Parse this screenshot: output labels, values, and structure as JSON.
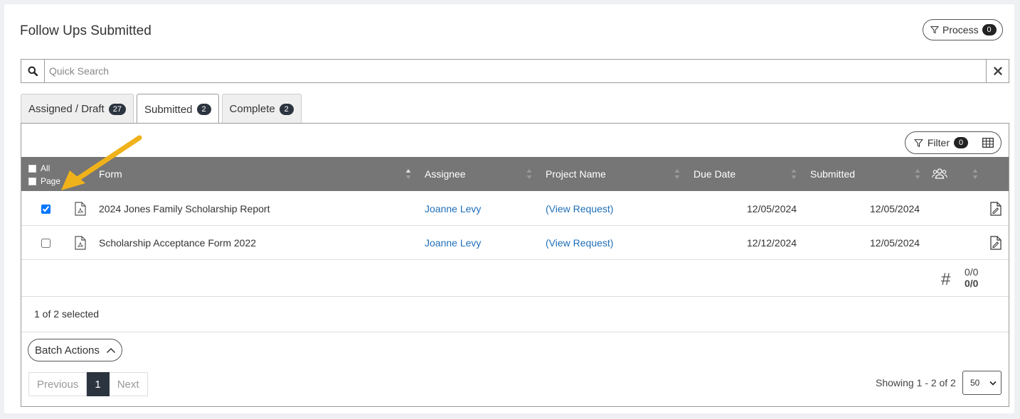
{
  "page": {
    "title": "Follow Ups Submitted"
  },
  "process": {
    "label": "Process",
    "count": "0"
  },
  "search": {
    "placeholder": "Quick Search"
  },
  "tabs": [
    {
      "label": "Assigned / Draft",
      "count": "27"
    },
    {
      "label": "Submitted",
      "count": "2"
    },
    {
      "label": "Complete",
      "count": "2"
    }
  ],
  "filter": {
    "label": "Filter",
    "count": "0"
  },
  "table": {
    "select_all_label": "All",
    "select_page_label": "Page",
    "columns": [
      "Form",
      "Assignee",
      "Project Name",
      "Due Date",
      "Submitted"
    ],
    "rows": [
      {
        "checked": true,
        "form": "2024 Jones Family Scholarship Report",
        "assignee": "Joanne Levy",
        "project": "(View Request)",
        "due": "12/05/2024",
        "submitted": "12/05/2024"
      },
      {
        "checked": false,
        "form": "Scholarship Acceptance Form 2022",
        "assignee": "Joanne Levy",
        "project": "(View Request)",
        "due": "12/12/2024",
        "submitted": "12/05/2024"
      }
    ]
  },
  "summary": {
    "value_top": "0/0",
    "value_bottom": "0/0"
  },
  "selection": {
    "text": "1 of 2 selected"
  },
  "batch": {
    "label": "Batch Actions"
  },
  "pagination": {
    "previous": "Previous",
    "current": "1",
    "next": "Next",
    "showing": "Showing 1 - 2 of 2",
    "per_page": "50"
  },
  "colors": {
    "header_bg": "#767676",
    "link": "#1f6fb8",
    "badge": "#2c3440",
    "arrow": "#f0b21a"
  }
}
